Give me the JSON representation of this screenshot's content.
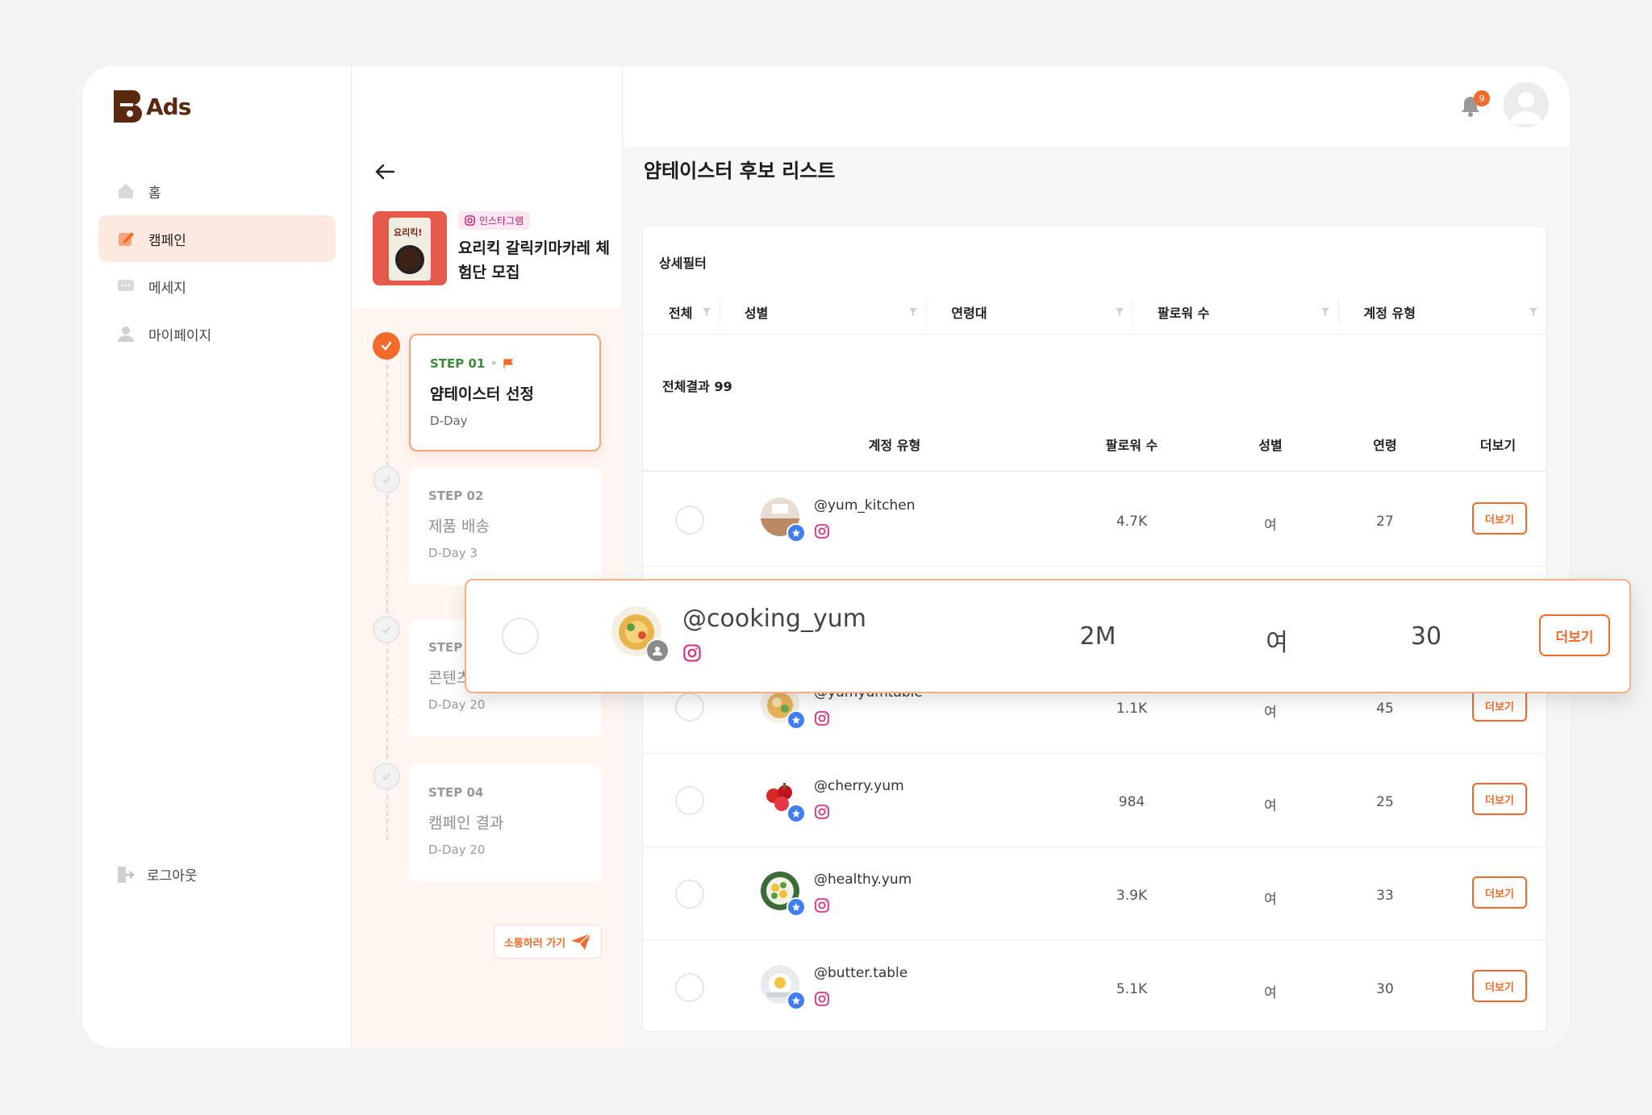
{
  "brand": {
    "name": "Ads"
  },
  "nav": {
    "items": [
      {
        "label": "홈",
        "icon": "home-icon"
      },
      {
        "label": "캠페인",
        "icon": "campaign-icon",
        "active": true
      },
      {
        "label": "메세지",
        "icon": "message-icon"
      },
      {
        "label": "마이페이지",
        "icon": "user-icon"
      }
    ],
    "logout": "로그아웃"
  },
  "campaign": {
    "platform": "인스타그램",
    "title": "요리킥 갈릭키마카레 체험단 모집",
    "thumb_text": "요리킥!",
    "steps": [
      {
        "num": "STEP 01",
        "title": "얌테이스터 선정",
        "day": "D-Day",
        "status": "active"
      },
      {
        "num": "STEP 02",
        "title": "제품 배송",
        "day": "D-Day 3",
        "status": "todo"
      },
      {
        "num": "STEP 03",
        "title": "콘텐츠",
        "day": "D-Day 20",
        "status": "todo"
      },
      {
        "num": "STEP 04",
        "title": "캠페인 결과",
        "day": "D-Day 20",
        "status": "todo"
      }
    ],
    "chat_button": "소통하러 가기"
  },
  "topbar": {
    "notification_count": "9"
  },
  "main": {
    "title": "얌테이스터 후보 리스트",
    "filter_title": "상세필터",
    "filters": [
      "전체",
      "성별",
      "연령대",
      "팔로워 수",
      "계정 유형"
    ],
    "total": "전체결과 99",
    "columns": [
      "계정 유형",
      "팔로워 수",
      "성별",
      "연령",
      "더보기"
    ],
    "more_label": "더보기",
    "rows": [
      {
        "handle": "@yum_kitchen",
        "followers": "4.7K",
        "gender": "여",
        "age": "27"
      },
      {
        "handle": "@cooking_yum",
        "followers": "2M",
        "gender": "여",
        "age": "30"
      },
      {
        "handle": "@yumyumtable",
        "followers": "1.1K",
        "gender": "여",
        "age": "45"
      },
      {
        "handle": "@cherry.yum",
        "followers": "984",
        "gender": "여",
        "age": "25"
      },
      {
        "handle": "@healthy.yum",
        "followers": "3.9K",
        "gender": "여",
        "age": "33"
      },
      {
        "handle": "@butter.table",
        "followers": "5.1K",
        "gender": "여",
        "age": "30"
      }
    ],
    "popup": {
      "handle": "@cooking_yum",
      "followers": "2M",
      "gender": "여",
      "age": "30"
    }
  },
  "colors": {
    "accent": "#f26b2a",
    "active_bg": "#fde9df",
    "step_green": "#3d8a3a",
    "verified": "#3f7ef5"
  }
}
